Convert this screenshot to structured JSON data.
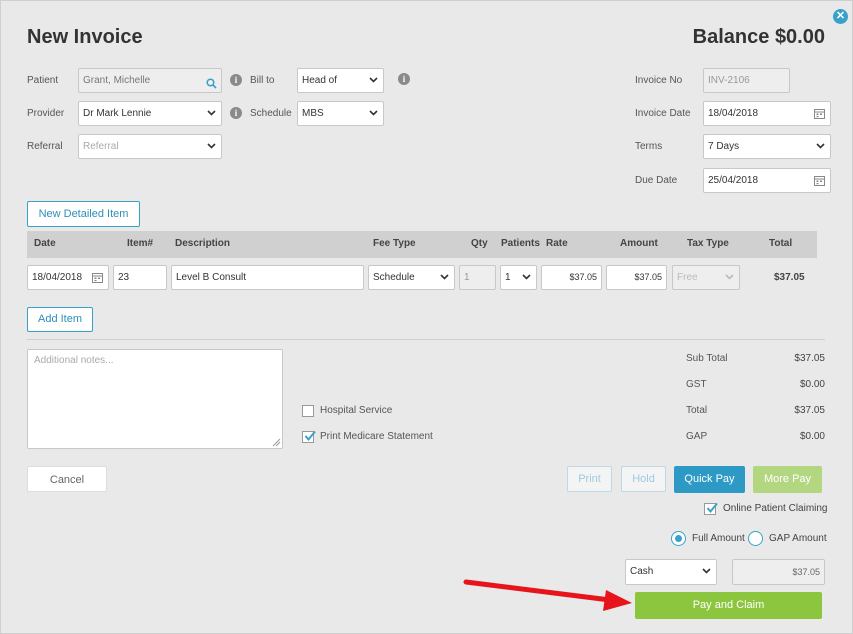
{
  "header": {
    "title": "New Invoice",
    "balance": "Balance $0.00"
  },
  "form": {
    "patient_label": "Patient",
    "patient_value": "Grant, Michelle",
    "provider_label": "Provider",
    "provider_value": "Dr Mark Lennie",
    "referral_label": "Referral",
    "referral_placeholder": "Referral",
    "bill_to_label": "Bill to",
    "bill_to_value": "Head of",
    "schedule_label": "Schedule",
    "schedule_value": "MBS",
    "invoice_no_label": "Invoice No",
    "invoice_no_value": "INV-2106",
    "invoice_date_label": "Invoice Date",
    "invoice_date_value": "18/04/2018",
    "terms_label": "Terms",
    "terms_value": "7 Days",
    "due_date_label": "Due Date",
    "due_date_value": "25/04/2018"
  },
  "items": {
    "new_detailed_label": "New Detailed Item",
    "add_item_label": "Add Item",
    "columns": [
      "Date",
      "Item#",
      "Description",
      "Fee Type",
      "Qty",
      "Patients",
      "Rate",
      "Amount",
      "Tax Type",
      "Total"
    ],
    "row": {
      "date": "18/04/2018",
      "item": "23",
      "description": "Level B Consult",
      "fee_type": "Schedule",
      "qty": "1",
      "patients": "1",
      "rate": "$37.05",
      "amount": "$37.05",
      "tax_type": "Free",
      "total": "$37.05"
    }
  },
  "notes": {
    "placeholder": "Additional notes..."
  },
  "options": {
    "hospital_service": "Hospital Service",
    "print_medicare": "Print Medicare Statement"
  },
  "totals": {
    "sub_total_label": "Sub Total",
    "sub_total": "$37.05",
    "gst_label": "GST",
    "gst": "$0.00",
    "total_label": "Total",
    "total": "$37.05",
    "gap_label": "GAP",
    "gap": "$0.00"
  },
  "actions": {
    "cancel": "Cancel",
    "print": "Print",
    "hold": "Hold",
    "quick_pay": "Quick Pay",
    "more_pay": "More Pay",
    "online_claiming": "Online Patient Claiming",
    "full_amount": "Full Amount",
    "gap_amount": "GAP Amount",
    "payment_method": "Cash",
    "pay_amount": "$37.05",
    "pay_and_claim": "Pay and Claim"
  },
  "colors": {
    "accent": "#39a1c9",
    "green": "#8cc63e",
    "arrow": "#e8141b"
  },
  "icons": [
    "close-icon",
    "search-icon",
    "info-icon",
    "chevron-down-icon",
    "calendar-icon",
    "check-icon"
  ]
}
